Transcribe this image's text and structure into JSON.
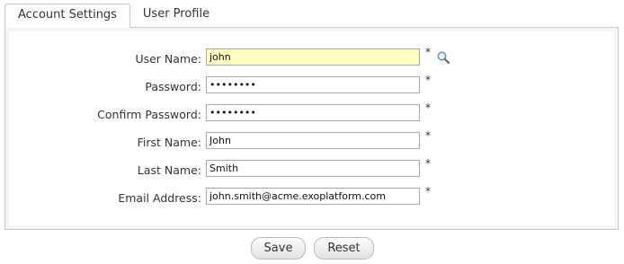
{
  "tabs": [
    {
      "label": "Account Settings",
      "active": true
    },
    {
      "label": "User Profile",
      "active": false
    }
  ],
  "form": {
    "required_marker": "*",
    "fields": [
      {
        "label": "User Name:",
        "value": "john"
      },
      {
        "label": "Password:",
        "value": "••••••••"
      },
      {
        "label": "Confirm Password:",
        "value": "••••••••"
      },
      {
        "label": "First Name:",
        "value": "John"
      },
      {
        "label": "Last Name:",
        "value": "Smith"
      },
      {
        "label": "Email Address:",
        "value": "john.smith@acme.exoplatform.com"
      }
    ],
    "lookup_icon": "magnifier-icon"
  },
  "buttons": {
    "save_label": "Save",
    "reset_label": "Reset"
  },
  "colors": {
    "highlight_field": "#ffffc0",
    "border": "#c9c9c9"
  }
}
